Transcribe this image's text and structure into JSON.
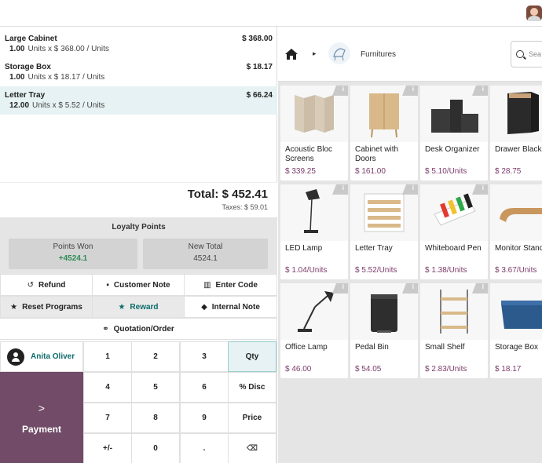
{
  "order_lines": [
    {
      "name": "Large Cabinet",
      "qty": "1.00",
      "detail": "Units x $ 368.00 / Units",
      "price": "$ 368.00"
    },
    {
      "name": "Storage Box",
      "qty": "1.00",
      "detail": "Units x $ 18.17 / Units",
      "price": "$ 18.17"
    },
    {
      "name": "Letter Tray",
      "qty": "12.00",
      "detail": "Units x $ 5.52 / Units",
      "price": "$ 66.24"
    }
  ],
  "totals": {
    "total": "Total: $ 452.41",
    "taxes": "Taxes: $ 59.01"
  },
  "loyalty": {
    "title": "Loyalty Points",
    "won_label": "Points Won",
    "won_value": "+4524.1",
    "total_label": "New Total",
    "total_value": "4524.1"
  },
  "controls": {
    "refund": "Refund",
    "customer_note": "Customer Note",
    "enter_code": "Enter Code",
    "reset_programs": "Reset Programs",
    "reward": "Reward",
    "internal_note": "Internal Note",
    "quotation": "Quotation/Order"
  },
  "customer": {
    "name": "Anita Oliver"
  },
  "payment": {
    "label": "Payment",
    "chevron": ">"
  },
  "numpad": {
    "k1": "1",
    "k2": "2",
    "k3": "3",
    "qty": "Qty",
    "k4": "4",
    "k5": "5",
    "k6": "6",
    "disc": "% Disc",
    "k7": "7",
    "k8": "8",
    "k9": "9",
    "price": "Price",
    "plusminus": "+/-",
    "k0": "0",
    "dot": ".",
    "backspace": "⌫"
  },
  "breadcrumb": {
    "separator": "▸",
    "category": "Furnitures"
  },
  "search": {
    "placeholder": "Sea"
  },
  "products": [
    {
      "name": "Acoustic Bloc Screens",
      "price": "$ 339.25"
    },
    {
      "name": "Cabinet with Doors",
      "price": "$ 161.00"
    },
    {
      "name": "Desk Organizer",
      "price": "$ 5.10/Units"
    },
    {
      "name": "Drawer Black",
      "price": "$ 28.75"
    },
    {
      "name": "LED Lamp",
      "price": "$ 1.04/Units"
    },
    {
      "name": "Letter Tray",
      "price": "$ 5.52/Units"
    },
    {
      "name": "Whiteboard Pen",
      "price": "$ 1.38/Units"
    },
    {
      "name": "Monitor Stand",
      "price": "$ 3.67/Units"
    },
    {
      "name": "Office Lamp",
      "price": "$ 46.00"
    },
    {
      "name": "Pedal Bin",
      "price": "$ 54.05"
    },
    {
      "name": "Small Shelf",
      "price": "$ 2.83/Units"
    },
    {
      "name": "Storage Box",
      "price": "$ 18.17"
    }
  ],
  "colors": {
    "accent": "#714b67",
    "teal": "#0d6b6b",
    "price": "#7b3b6b"
  }
}
